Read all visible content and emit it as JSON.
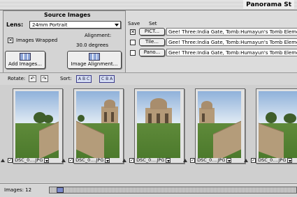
{
  "window": {
    "title": "Panorama St"
  },
  "source_images": {
    "heading": "Source Images",
    "lens_label": "Lens:",
    "lens_value": "24mm Portrait",
    "images_wrapped_label": "Images Wrapped",
    "images_wrapped_checked": "✕",
    "alignment_label": "Alignment:",
    "alignment_value": "30.0 degrees",
    "add_images_label": "Add Images...",
    "image_alignment_label": "Image Alignment..."
  },
  "save_set": {
    "save_header": "Save",
    "set_header": "Set",
    "rows": [
      {
        "checked": "✕",
        "button": "PICT...",
        "value": "Gee! Three:India Gate, Tomb:Humayun's Tomb Element"
      },
      {
        "checked": "",
        "button": "Tile...",
        "value": "Gee! Three:India Gate, Tomb:Humayun's Tomb Element"
      },
      {
        "checked": "",
        "button": "Pano...",
        "value": "Gee! Three:India Gate, Tomb:Humayun's Tomb Element"
      }
    ]
  },
  "toolbar": {
    "rotate_label": "Rotate:",
    "rotate_left": "↶",
    "rotate_right": "↷",
    "sort_label": "Sort:",
    "sort_asc": "A B C",
    "sort_desc": "C B A"
  },
  "thumbnails": [
    {
      "name": "DSC_0....JPG",
      "checked": "✓"
    },
    {
      "name": "DSC_0....JPG",
      "checked": "✓"
    },
    {
      "name": "DSC_0....JPG",
      "checked": "✓"
    },
    {
      "name": "DSC_0....JPG",
      "checked": "✓"
    },
    {
      "name": "DSC_0....JPG",
      "checked": "✓"
    }
  ],
  "status": {
    "images_count": "Images: 12"
  }
}
